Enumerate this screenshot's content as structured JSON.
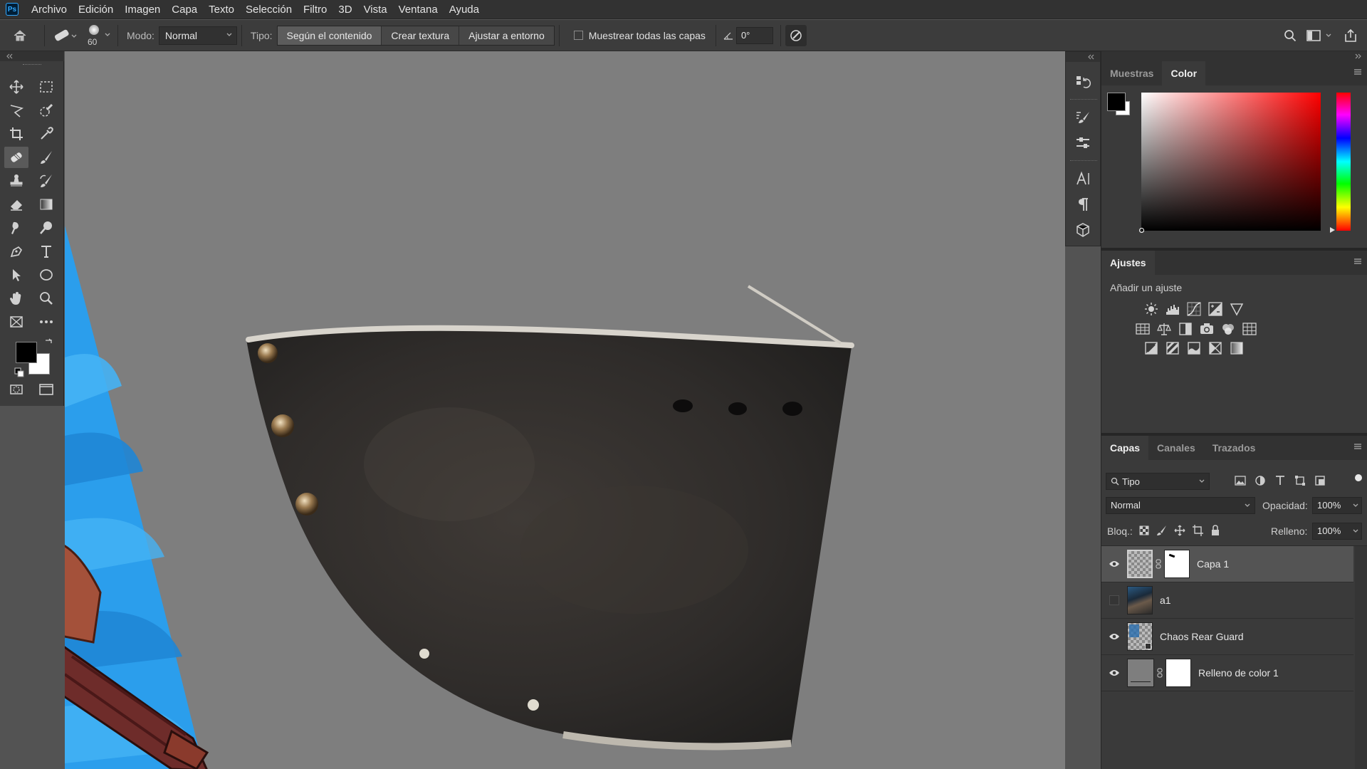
{
  "app": {
    "logo": "Ps"
  },
  "menu": [
    "Archivo",
    "Edición",
    "Imagen",
    "Capa",
    "Texto",
    "Selección",
    "Filtro",
    "3D",
    "Vista",
    "Ventana",
    "Ayuda"
  ],
  "options": {
    "brush_size": "60",
    "mode_label": "Modo:",
    "mode_value": "Normal",
    "type_label": "Tipo:",
    "type_buttons": [
      "Según el contenido",
      "Crear textura",
      "Ajustar a entorno"
    ],
    "sample_all_label": "Muestrear todas las capas",
    "angle_value": "0°"
  },
  "color_panel": {
    "tabs": [
      "Muestras",
      "Color"
    ],
    "active_tab": "Color",
    "foreground": "#000000",
    "background": "#ffffff",
    "hue_color": "#ff0000"
  },
  "adjustments": {
    "title": "Ajustes",
    "subtitle": "Añadir un ajuste"
  },
  "layers_panel": {
    "tabs": [
      "Capas",
      "Canales",
      "Trazados"
    ],
    "active_tab": "Capas",
    "filter_value": "Tipo",
    "blend_mode": "Normal",
    "opacity_label": "Opacidad:",
    "opacity_value": "100%",
    "lock_label": "Bloq.:",
    "fill_label": "Relleno:",
    "fill_value": "100%",
    "layers": [
      {
        "name": "Capa 1",
        "visible": true,
        "selected": true
      },
      {
        "name": "a1",
        "visible": false,
        "selected": false
      },
      {
        "name": "Chaos Rear Guard",
        "visible": true,
        "selected": false
      },
      {
        "name": "Relleno de color 1",
        "visible": true,
        "selected": false
      }
    ]
  }
}
